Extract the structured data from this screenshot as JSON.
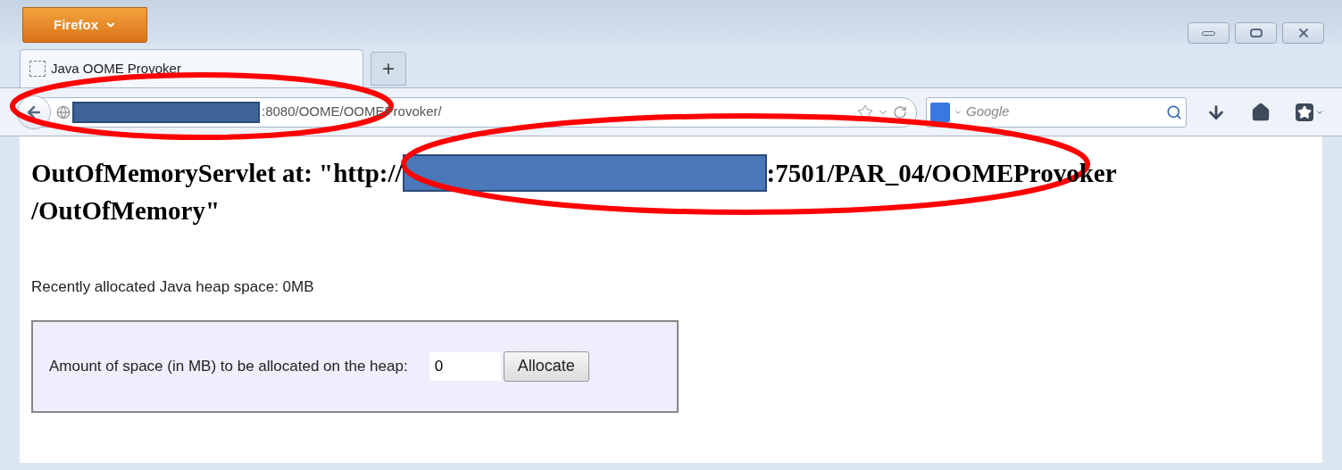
{
  "browser": {
    "menu_button": "Firefox",
    "tabs": [
      {
        "title": "Java OOME Provoker",
        "selected": true
      }
    ],
    "new_tab": "+",
    "address": ":8080/OOME/OOMEProvoker/",
    "search_placeholder": "Google"
  },
  "page": {
    "heading_before": "OutOfMemoryServlet at: \"http://",
    "heading_after": ":7501/PAR_04/OOMEProvoker",
    "heading_line2": "/OutOfMemory\"",
    "status": "Recently allocated Java heap space: 0MB",
    "form": {
      "label": "Amount of space (in MB) to be allocated on the heap:",
      "value": "0",
      "button": "Allocate"
    }
  }
}
